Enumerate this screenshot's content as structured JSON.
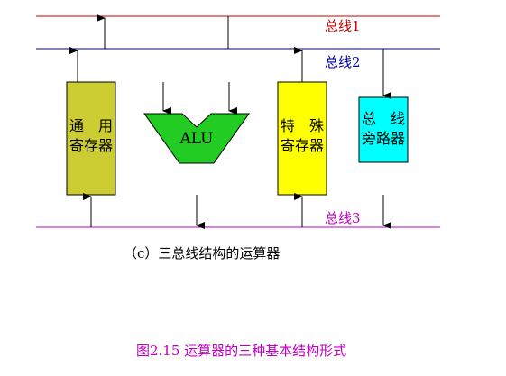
{
  "buses": [
    {
      "label": "总线1",
      "color": "#c00000"
    },
    {
      "label": "总线2",
      "color": "#0000a0"
    },
    {
      "label": "总线3",
      "color": "#c000c0"
    }
  ],
  "blocks": {
    "general_registers": {
      "line1": "通　用",
      "line2": "寄存器",
      "fill": "#cccc33"
    },
    "alu": {
      "label": "ALU",
      "fill": "#22cc22"
    },
    "special_registers": {
      "line1": "特　殊",
      "line2": "寄存器",
      "fill": "#ffff00"
    },
    "bus_bypass": {
      "line1": "总　线",
      "line2": "旁路器",
      "fill": "#00ffff"
    }
  },
  "subcaption": "（c）三总线结构的运算器",
  "figure_caption": "图2.15 运算器的三种基本结构形式",
  "colors": {
    "figure_caption": "#c000c0",
    "line": "#000000"
  }
}
